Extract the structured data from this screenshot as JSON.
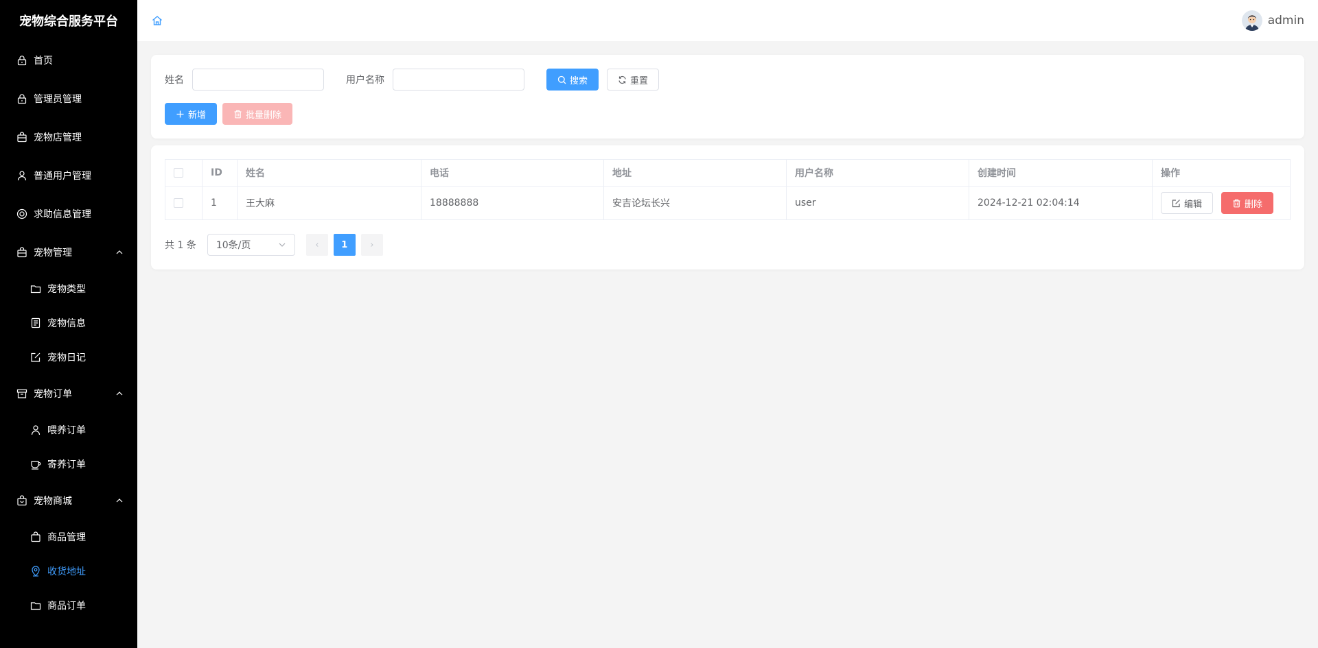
{
  "colors": {
    "accent": "#409eff",
    "danger": "#f56c6c",
    "sidebar_bg": "#000000"
  },
  "sidebar": {
    "title": "宠物综合服务平台",
    "items": [
      {
        "label": "首页",
        "icon": "lock-icon"
      },
      {
        "label": "管理员管理",
        "icon": "lock-icon"
      },
      {
        "label": "宠物店管理",
        "icon": "shop-bag-icon"
      },
      {
        "label": "普通用户管理",
        "icon": "user-icon"
      },
      {
        "label": "求助信息管理",
        "icon": "help-ring-icon"
      }
    ],
    "groups": [
      {
        "label": "宠物管理",
        "icon": "shop-bag-icon",
        "expanded": true,
        "children": [
          {
            "label": "宠物类型",
            "icon": "folder-icon"
          },
          {
            "label": "宠物信息",
            "icon": "document-icon"
          },
          {
            "label": "宠物日记",
            "icon": "edit-icon"
          }
        ]
      },
      {
        "label": "宠物订单",
        "icon": "box-icon",
        "expanded": true,
        "children": [
          {
            "label": "喂养订单",
            "icon": "user-icon"
          },
          {
            "label": "寄养订单",
            "icon": "cup-icon"
          }
        ]
      },
      {
        "label": "宠物商城",
        "icon": "handbag-icon",
        "expanded": true,
        "children": [
          {
            "label": "商品管理",
            "icon": "shop-bag-icon"
          },
          {
            "label": "收货地址",
            "icon": "location-icon",
            "active": true
          },
          {
            "label": "商品订单",
            "icon": "folder-icon"
          }
        ]
      }
    ]
  },
  "header": {
    "username": "admin"
  },
  "search": {
    "name_label": "姓名",
    "name_value": "",
    "username_label": "用户名称",
    "username_value": "",
    "search_button": "搜索",
    "reset_button": "重置",
    "add_button": "新增",
    "batch_delete_button": "批量删除"
  },
  "table": {
    "columns": [
      "ID",
      "姓名",
      "电话",
      "地址",
      "用户名称",
      "创建时间",
      "操作"
    ],
    "rows": [
      {
        "id": "1",
        "name": "王大麻",
        "phone": "18888888",
        "address": "安吉论坛长兴",
        "username": "user",
        "created": "2024-12-21 02:04:14",
        "edit_label": "编辑",
        "delete_label": "删除"
      }
    ]
  },
  "pagination": {
    "total_text": "共 1 条",
    "page_size": "10条/页",
    "current_page": "1",
    "prev": "‹",
    "next": "›"
  }
}
